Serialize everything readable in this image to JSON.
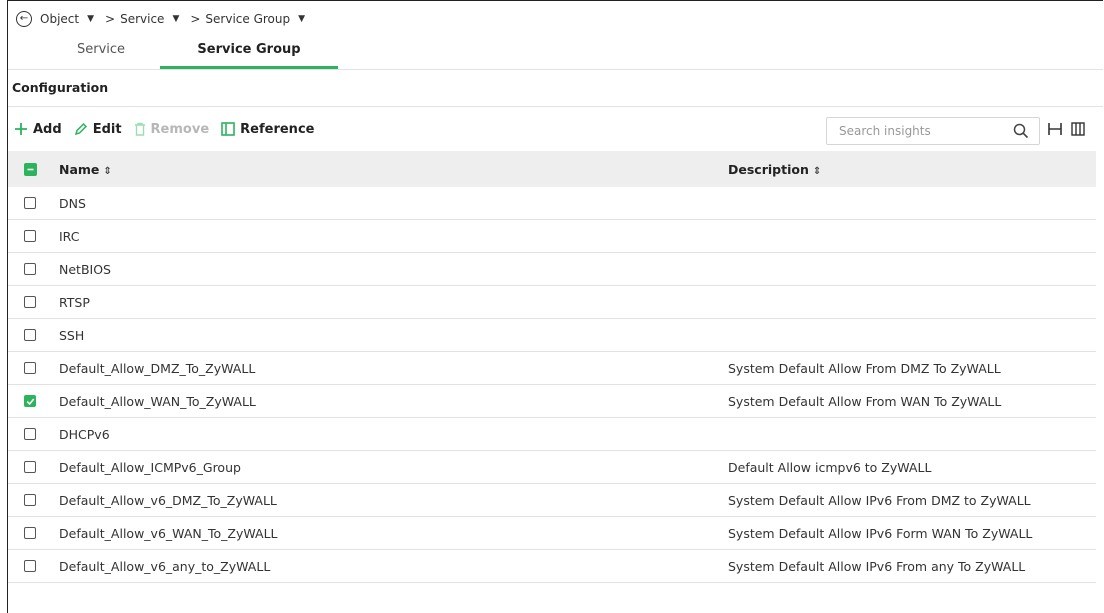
{
  "breadcrumb": {
    "items": [
      {
        "label": "Object"
      },
      {
        "label": "Service"
      },
      {
        "label": "Service Group"
      }
    ],
    "separator": ">"
  },
  "tabs": [
    {
      "label": "Service",
      "active": false
    },
    {
      "label": "Service Group",
      "active": true
    }
  ],
  "section_title": "Configuration",
  "toolbar": {
    "add_label": "Add",
    "edit_label": "Edit",
    "remove_label": "Remove",
    "reference_label": "Reference"
  },
  "search": {
    "placeholder": "Search insights",
    "value": ""
  },
  "table": {
    "columns": [
      {
        "label": "Name",
        "sort_icon": "sort-icon"
      },
      {
        "label": "Description",
        "sort_icon": "sort-icon"
      }
    ],
    "rows": [
      {
        "name": "DNS",
        "description": "",
        "checked": false
      },
      {
        "name": "IRC",
        "description": "",
        "checked": false
      },
      {
        "name": "NetBIOS",
        "description": "",
        "checked": false
      },
      {
        "name": "RTSP",
        "description": "",
        "checked": false
      },
      {
        "name": "SSH",
        "description": "",
        "checked": false
      },
      {
        "name": "Default_Allow_DMZ_To_ZyWALL",
        "description": "System Default Allow From DMZ To ZyWALL",
        "checked": false
      },
      {
        "name": "Default_Allow_WAN_To_ZyWALL",
        "description": "System Default Allow From WAN To ZyWALL",
        "checked": true
      },
      {
        "name": "DHCPv6",
        "description": "",
        "checked": false
      },
      {
        "name": "Default_Allow_ICMPv6_Group",
        "description": "Default Allow icmpv6 to ZyWALL",
        "checked": false
      },
      {
        "name": "Default_Allow_v6_DMZ_To_ZyWALL",
        "description": "System Default Allow IPv6 From DMZ to ZyWALL",
        "checked": false
      },
      {
        "name": "Default_Allow_v6_WAN_To_ZyWALL",
        "description": "System Default Allow IPv6 Form WAN To ZyWALL",
        "checked": false
      },
      {
        "name": "Default_Allow_v6_any_to_ZyWALL",
        "description": "System Default Allow IPv6 From any To ZyWALL",
        "checked": false
      }
    ]
  },
  "colors": {
    "accent": "#2db35d",
    "header_bg": "#eeeeee",
    "disabled": "#b7b7b7"
  }
}
